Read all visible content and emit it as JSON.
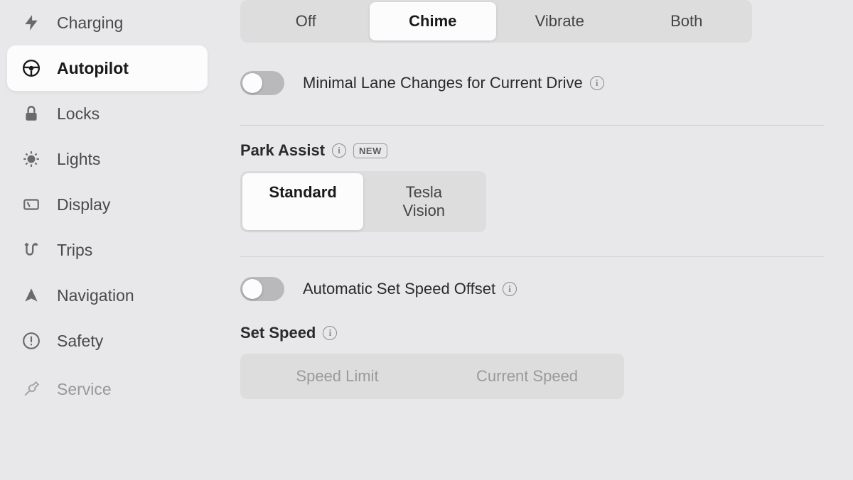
{
  "sidebar": {
    "items": [
      {
        "label": "Charging",
        "icon": "bolt"
      },
      {
        "label": "Autopilot",
        "icon": "steering-wheel",
        "active": true
      },
      {
        "label": "Locks",
        "icon": "lock"
      },
      {
        "label": "Lights",
        "icon": "brightness"
      },
      {
        "label": "Display",
        "icon": "display"
      },
      {
        "label": "Trips",
        "icon": "route"
      },
      {
        "label": "Navigation",
        "icon": "arrow"
      },
      {
        "label": "Safety",
        "icon": "alert"
      },
      {
        "label": "Service",
        "icon": "wrench"
      }
    ]
  },
  "alert_segmented": {
    "options": [
      "Off",
      "Chime",
      "Vibrate",
      "Both"
    ],
    "selected": "Chime"
  },
  "minimal_lane": {
    "label": "Minimal Lane Changes for Current Drive",
    "value": false
  },
  "park_assist": {
    "title": "Park Assist",
    "badge": "NEW",
    "options": [
      "Standard",
      "Tesla Vision"
    ],
    "selected": "Standard"
  },
  "auto_offset": {
    "label": "Automatic Set Speed Offset",
    "value": false
  },
  "set_speed": {
    "title": "Set Speed",
    "options": [
      "Speed Limit",
      "Current Speed"
    ]
  }
}
